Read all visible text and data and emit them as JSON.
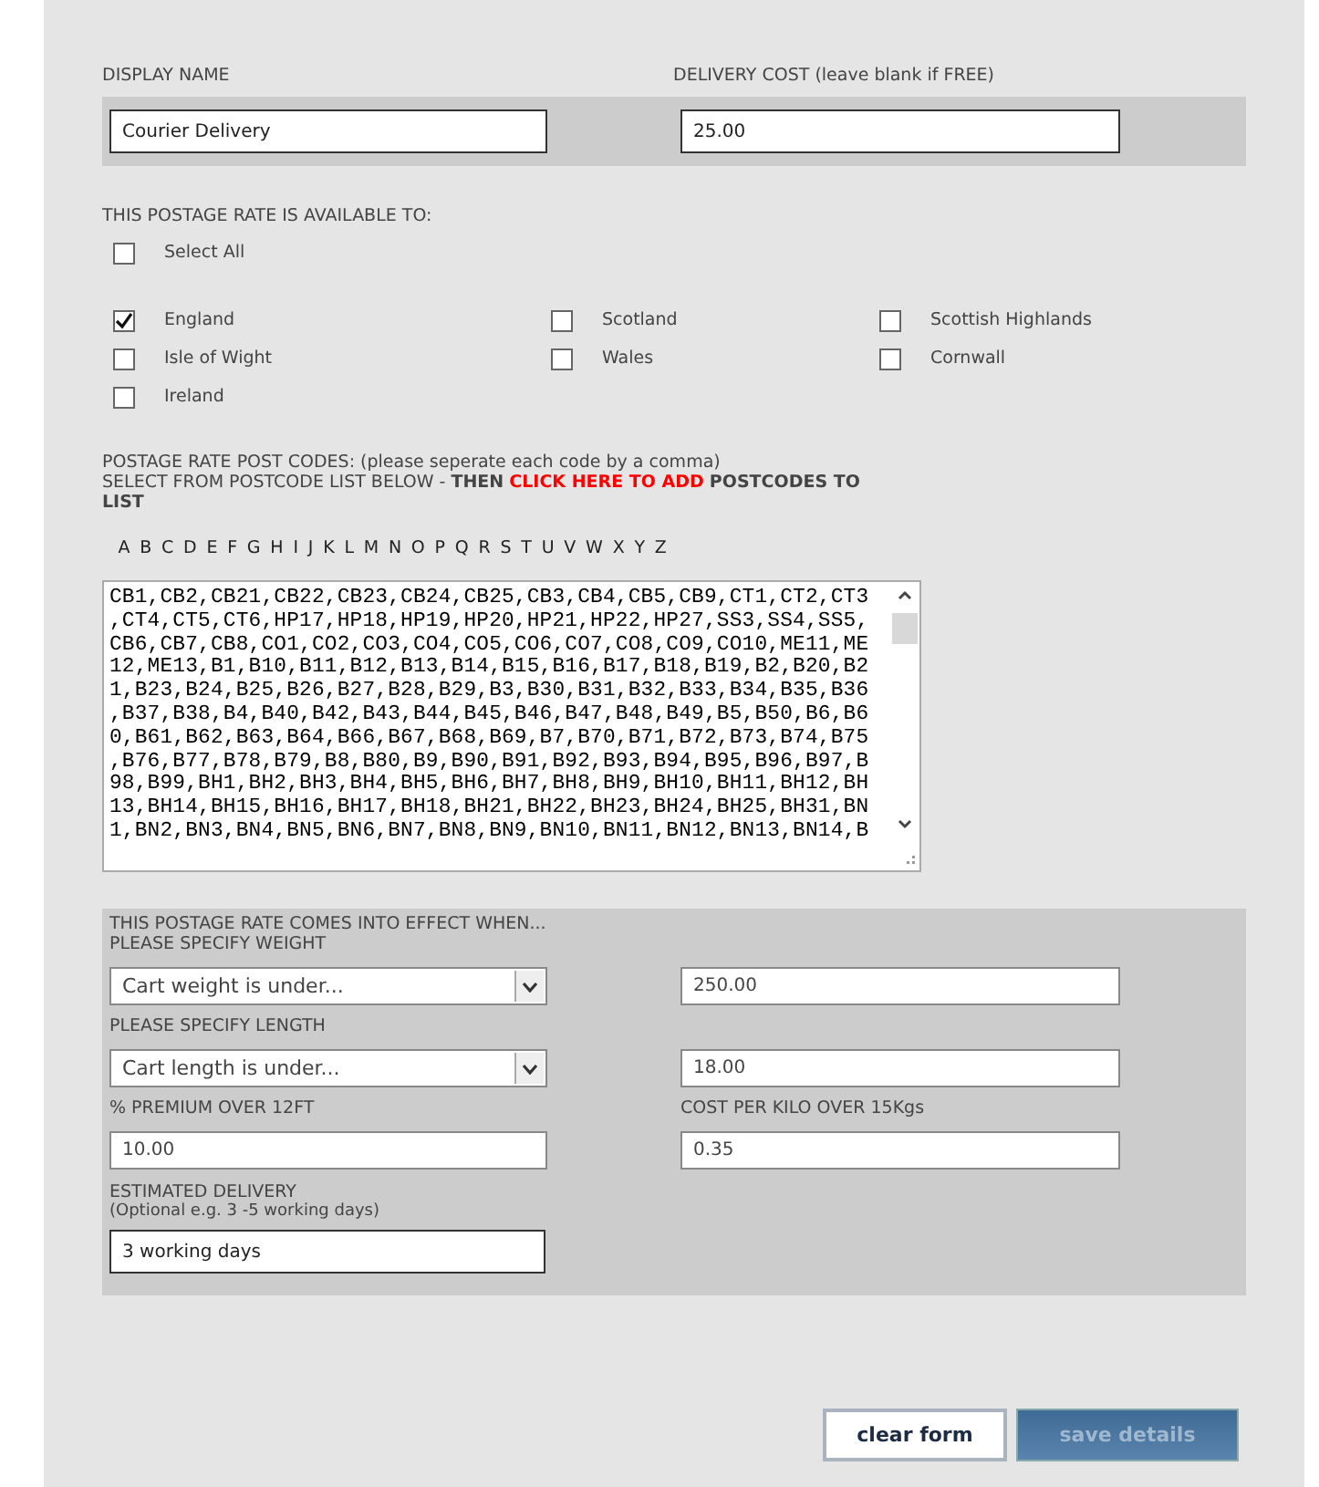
{
  "display_name": {
    "label": "DISPLAY NAME",
    "value": "Courier Delivery"
  },
  "delivery_cost": {
    "label": "DELIVERY COST (leave blank if FREE)",
    "value": "25.00"
  },
  "availability": {
    "heading": "THIS POSTAGE RATE IS AVAILABLE TO:",
    "select_all": {
      "label": "Select All",
      "checked": false
    },
    "regions": [
      {
        "label": "England",
        "checked": true
      },
      {
        "label": "Scotland",
        "checked": false
      },
      {
        "label": "Scottish Highlands",
        "checked": false
      },
      {
        "label": "Isle of Wight",
        "checked": false
      },
      {
        "label": "Wales",
        "checked": false
      },
      {
        "label": "Cornwall",
        "checked": false
      },
      {
        "label": "Ireland",
        "checked": false
      }
    ]
  },
  "postcodes": {
    "heading": "POSTAGE RATE POST CODES: (please seperate each code by a comma)",
    "instruction_prefix": "SELECT FROM POSTCODE LIST BELOW - **THEN**",
    "instruction_link": "CLICK HERE TO ADD",
    "instruction_suffix": "**POSTCODES TO LIST**",
    "letters": [
      "A",
      "B",
      "C",
      "D",
      "E",
      "F",
      "G",
      "H",
      "I",
      "J",
      "K",
      "L",
      "M",
      "N",
      "O",
      "P",
      "Q",
      "R",
      "S",
      "T",
      "U",
      "V",
      "W",
      "X",
      "Y",
      "Z"
    ],
    "lines": [
      "CB1,CB2,CB21,CB22,CB23,CB24,CB25,CB3,CB4,CB5,CB9,CT1,CT2,CT3",
      ",CT4,CT5,CT6,HP17,HP18,HP19,HP20,HP21,HP22,HP27,SS3,SS4,SS5,",
      "CB6,CB7,CB8,CO1,CO2,CO3,CO4,CO5,CO6,CO7,CO8,CO9,CO10,ME11,ME",
      "12,ME13,B1,B10,B11,B12,B13,B14,B15,B16,B17,B18,B19,B2,B20,B2",
      "1,B23,B24,B25,B26,B27,B28,B29,B3,B30,B31,B32,B33,B34,B35,B36",
      ",B37,B38,B4,B40,B42,B43,B44,B45,B46,B47,B48,B49,B5,B50,B6,B6",
      "0,B61,B62,B63,B64,B66,B67,B68,B69,B7,B70,B71,B72,B73,B74,B75",
      ",B76,B77,B78,B79,B8,B80,B9,B90,B91,B92,B93,B94,B95,B96,B97,B",
      "98,B99,BH1,BH2,BH3,BH4,BH5,BH6,BH7,BH8,BH9,BH10,BH11,BH12,BH",
      "13,BH14,BH15,BH16,BH17,BH18,BH21,BH22,BH23,BH24,BH25,BH31,BN",
      "1,BN2,BN3,BN4,BN5,BN6,BN7,BN8,BN9,BN10,BN11,BN12,BN13,BN14,B"
    ]
  },
  "conditions": {
    "heading": "THIS POSTAGE RATE COMES INTO EFFECT WHEN...",
    "weight": {
      "label": "PLEASE SPECIFY WEIGHT",
      "select": "Cart weight is under...",
      "value": "250.00"
    },
    "length": {
      "label": "PLEASE SPECIFY LENGTH",
      "select": "Cart length is under...",
      "value": "18.00"
    },
    "premium": {
      "label": "% PREMIUM OVER 12FT",
      "value": "10.00"
    },
    "cost_per_kilo": {
      "label": "COST PER KILO OVER 15Kgs",
      "value": "0.35"
    },
    "estimated_delivery": {
      "label": "ESTIMATED DELIVERY",
      "hint": "(Optional e.g. 3 -5 working days)",
      "value": "3 working days"
    }
  },
  "buttons": {
    "clear": "clear form",
    "save": "save details"
  }
}
